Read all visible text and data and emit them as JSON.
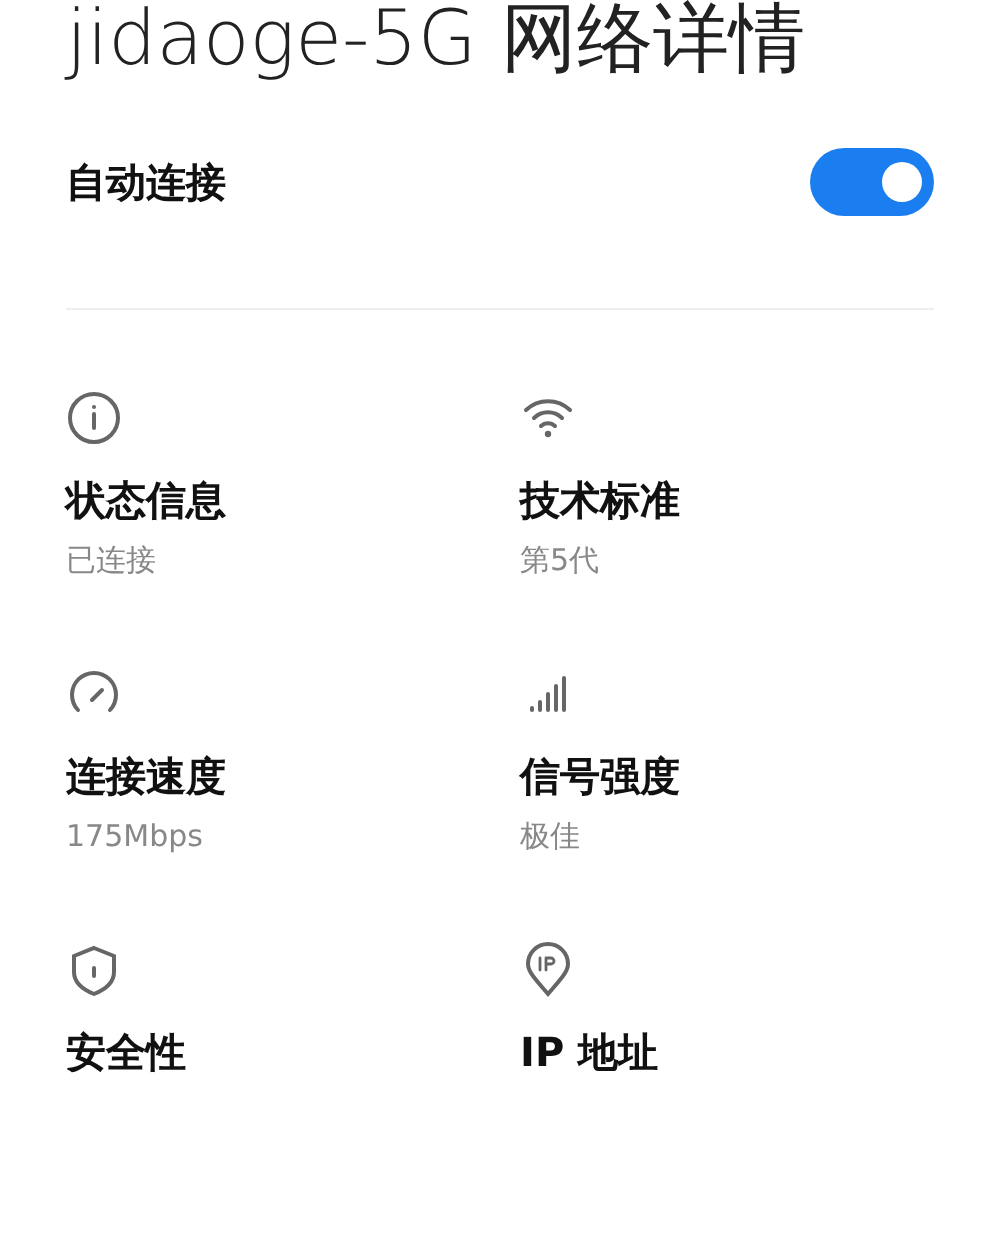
{
  "title": "jidaoge-5G 网络详情",
  "auto_connect": {
    "label": "自动连接",
    "on": true
  },
  "details": [
    {
      "kind": "info",
      "label": "状态信息",
      "value": "已连接"
    },
    {
      "kind": "wifi",
      "label": "技术标准",
      "value": "第5代"
    },
    {
      "kind": "speed",
      "label": "连接速度",
      "value": "175Mbps"
    },
    {
      "kind": "signal",
      "label": "信号强度",
      "value": "极佳"
    },
    {
      "kind": "shield",
      "label": "安全性"
    },
    {
      "kind": "ip",
      "label": "IP 地址"
    }
  ]
}
